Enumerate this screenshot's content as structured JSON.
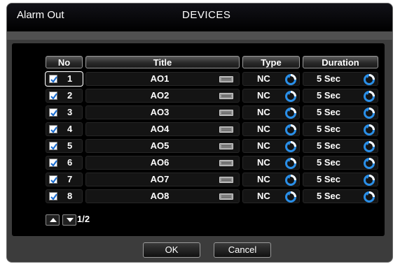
{
  "window": {
    "section_label": "Alarm Out",
    "title": "DEVICES"
  },
  "table": {
    "headers": {
      "no": "No",
      "title": "Title",
      "type": "Type",
      "duration": "Duration"
    },
    "rows": [
      {
        "checked": true,
        "no": "1",
        "title": "AO1",
        "type": "NC",
        "duration": "5 Sec"
      },
      {
        "checked": true,
        "no": "2",
        "title": "AO2",
        "type": "NC",
        "duration": "5 Sec"
      },
      {
        "checked": true,
        "no": "3",
        "title": "AO3",
        "type": "NC",
        "duration": "5 Sec"
      },
      {
        "checked": true,
        "no": "4",
        "title": "AO4",
        "type": "NC",
        "duration": "5 Sec"
      },
      {
        "checked": true,
        "no": "5",
        "title": "AO5",
        "type": "NC",
        "duration": "5 Sec"
      },
      {
        "checked": true,
        "no": "6",
        "title": "AO6",
        "type": "NC",
        "duration": "5 Sec"
      },
      {
        "checked": true,
        "no": "7",
        "title": "AO7",
        "type": "NC",
        "duration": "5 Sec"
      },
      {
        "checked": true,
        "no": "8",
        "title": "AO8",
        "type": "NC",
        "duration": "5 Sec"
      }
    ]
  },
  "pagination": {
    "indicator": "1/2"
  },
  "buttons": {
    "ok": "OK",
    "cancel": "Cancel"
  },
  "icons": {
    "checkbox": "checkmark-icon",
    "keyboard": "keyboard-icon",
    "cycle": "cycle-arrow-icon",
    "page_up": "arrow-up-icon",
    "page_down": "arrow-down-icon"
  },
  "colors": {
    "accent": "#1e6fd1",
    "check": "#1e6fd1",
    "panel": "#000000",
    "frame": "#3c3c3c"
  }
}
